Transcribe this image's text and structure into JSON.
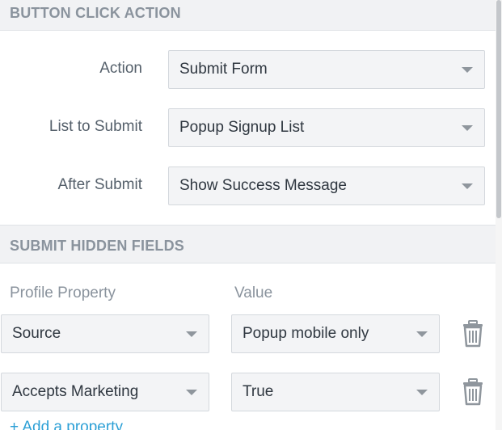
{
  "sections": {
    "button_click_action": {
      "title": "BUTTON CLICK ACTION",
      "rows": [
        {
          "label": "Action",
          "value": "Submit Form"
        },
        {
          "label": "List to Submit",
          "value": "Popup Signup List"
        },
        {
          "label": "After Submit",
          "value": "Show Success Message"
        }
      ]
    },
    "submit_hidden_fields": {
      "title": "SUBMIT HIDDEN FIELDS",
      "columns": {
        "property": "Profile Property",
        "value": "Value"
      },
      "fields": [
        {
          "property": "Source",
          "value": "Popup mobile only"
        },
        {
          "property": "Accepts Marketing",
          "value": "True"
        }
      ],
      "add_link": "+ Add a property"
    }
  },
  "icons": {
    "dropdown": "chevron-down-icon",
    "delete": "trash-icon"
  },
  "colors": {
    "header_bg": "#f1f2f4",
    "header_text": "#8a939d",
    "select_bg": "#f3f4f6",
    "link": "#2da0d6",
    "icon": "#8f969d"
  }
}
